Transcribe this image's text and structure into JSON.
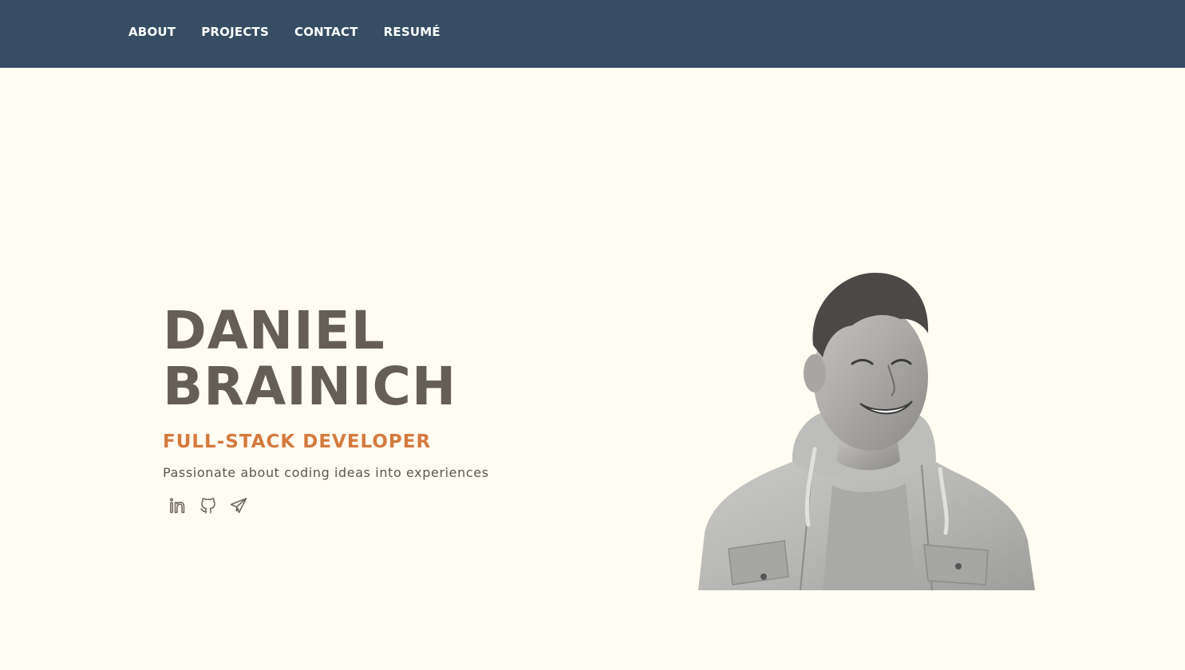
{
  "nav": {
    "items": [
      {
        "label": "ABOUT"
      },
      {
        "label": "PROJECTS"
      },
      {
        "label": "CONTACT"
      },
      {
        "label": "RESUMÉ"
      }
    ]
  },
  "hero": {
    "first_name": "DANIEL",
    "last_name": "BRAINICH",
    "role": "FULL-STACK DEVELOPER",
    "tagline": "Passionate about coding ideas into experiences"
  },
  "socials": [
    {
      "icon": "linkedin-icon"
    },
    {
      "icon": "github-icon"
    },
    {
      "icon": "paper-plane-icon"
    }
  ],
  "colors": {
    "nav_bg": "#364D65",
    "page_bg": "#FFFCF2",
    "name": "#655E54",
    "accent": "#D57A3E",
    "text": "#5C574F"
  }
}
